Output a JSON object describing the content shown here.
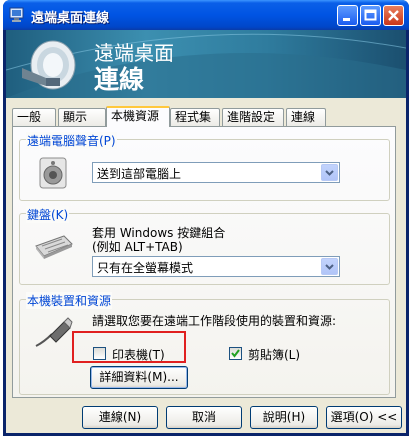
{
  "window": {
    "title": "遠端桌面連線",
    "controls": [
      "minimize",
      "maximize",
      "close"
    ]
  },
  "banner": {
    "line1": "遠端桌面",
    "line2": "連線"
  },
  "tabs": [
    "一般",
    "顯示",
    "本機資源",
    "程式集",
    "進階設定",
    "連線"
  ],
  "active_tab": "本機資源",
  "audio_group": {
    "legend": "遠端電腦聲音(P)",
    "select_value": "送到這部電腦上"
  },
  "keyboard_group": {
    "legend": "鍵盤(K)",
    "description_line1": "套用 Windows 按鍵組合",
    "description_line2": "(例如 ALT+TAB)",
    "select_value": "只有在全螢幕模式"
  },
  "devices_group": {
    "legend": "本機裝置和資源",
    "instruction": "請選取您要在遠端工作階段使用的裝置和資源:",
    "printer_label": "印表機(T)",
    "printer_checked": false,
    "clipboard_label": "剪貼簿(L)",
    "clipboard_checked": true,
    "details_button": "詳細資料(M)..."
  },
  "footer": {
    "connect": "連線(N)",
    "cancel": "取消",
    "help": "說明(H)",
    "options": "選項(O) <<"
  },
  "colors": {
    "titlebar": "#0054e3",
    "legend_text": "#0046d5",
    "highlight_box": "#e02020",
    "tab_active_accent": "#ffc83c"
  }
}
